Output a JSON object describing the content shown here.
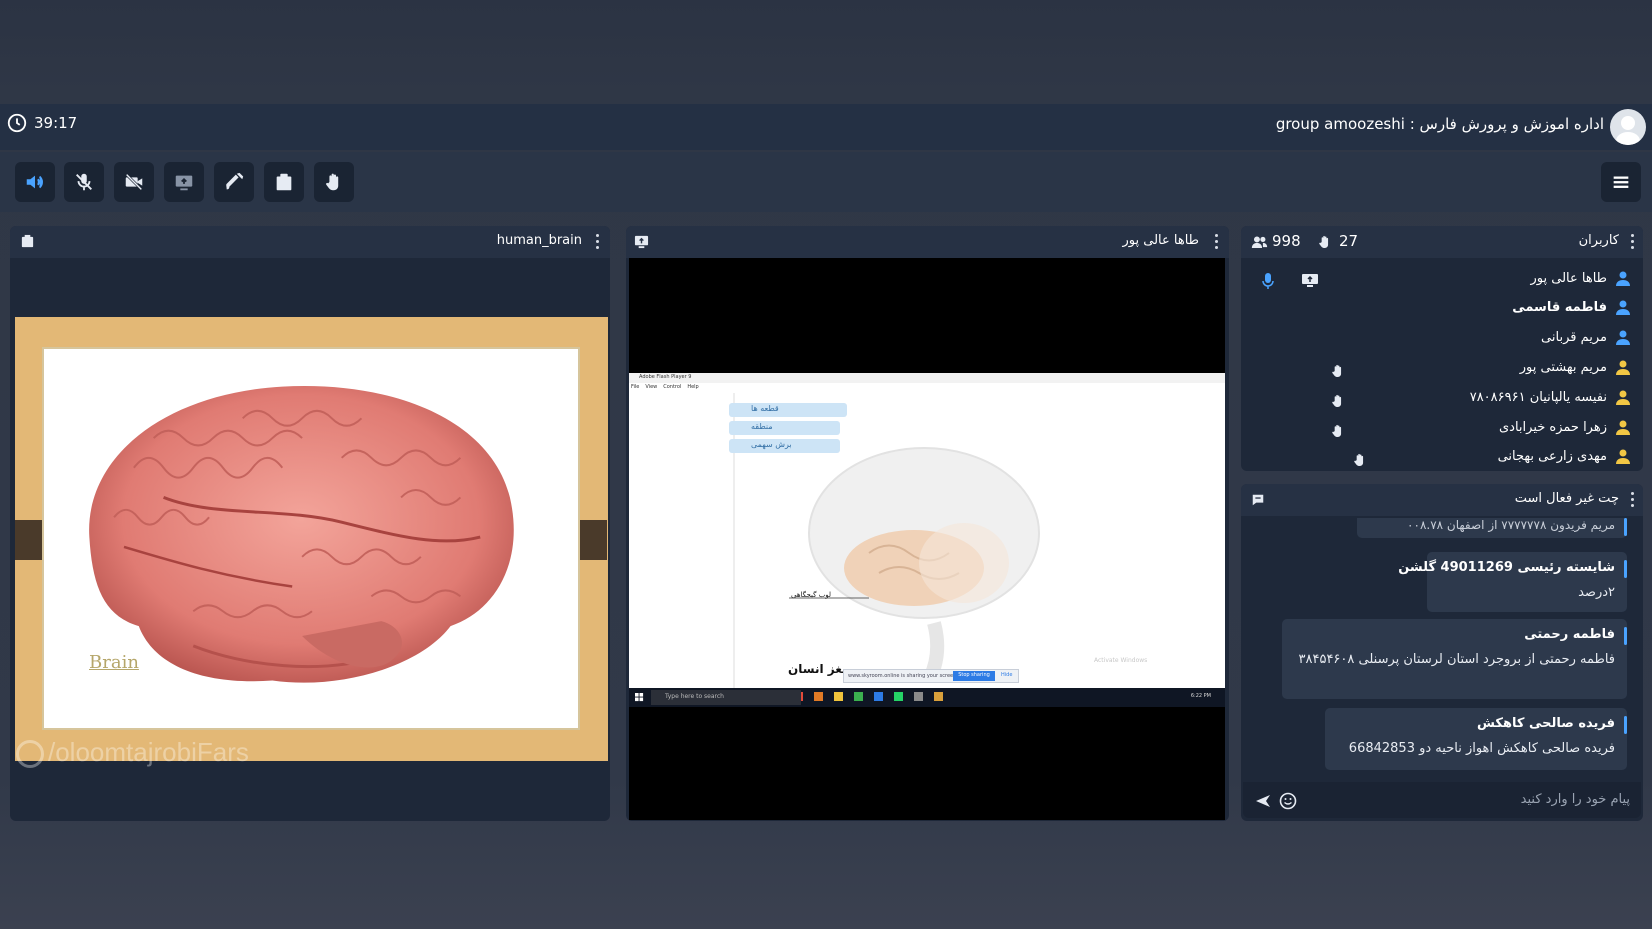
{
  "header": {
    "timer": "39:17",
    "room_title": "اداره اموزش و پرورش فارس : group amoozeshi"
  },
  "toolbar": {
    "buttons": [
      "speaker-icon",
      "mic-off-icon",
      "camera-off-icon",
      "screen-share-icon",
      "pen-icon",
      "whiteboard-icon",
      "raise-hand-icon"
    ],
    "accent_color": "#4aa3ff"
  },
  "left_panel": {
    "title": "human_brain",
    "slide_label": "Brain",
    "watermark": "/oloomtajrobiFars"
  },
  "middle_panel": {
    "title": "طاها عالی پور",
    "screen": {
      "window_title": "Adobe Flash Player 9",
      "menu_items": [
        "File",
        "View",
        "Control",
        "Help"
      ],
      "buttons": [
        "قطعه ها",
        "منطقه",
        "برش سهمی"
      ],
      "lobe_label": "لوب گیجگاهی",
      "caption": "مغز انسان",
      "share_text": "www.skyroom.online is sharing your screen.",
      "stop_sharing": "Stop sharing",
      "hide": "Hide",
      "search_placeholder": "Type here to search",
      "activate": "Activate Windows",
      "clock": "6:22 PM"
    }
  },
  "users_panel": {
    "title": "کاربران",
    "user_count": "998",
    "hand_count": "27",
    "users": [
      {
        "name": "طاها عالی پور",
        "role_color": "#4aa3ff",
        "bold": false
      },
      {
        "name": "فاطمه قاسمی",
        "role_color": "#4aa3ff",
        "bold": true
      },
      {
        "name": "مریم قربانی",
        "role_color": "#4aa3ff",
        "bold": false
      },
      {
        "name": "مریم بهشتی پور",
        "role_color": "#f2c744",
        "bold": false
      },
      {
        "name": "نفیسه یالپانیان ۷۸۰۸۶۹۶۱",
        "role_color": "#f2c744",
        "bold": false
      },
      {
        "name": "زهرا حمزه خیرابادی",
        "role_color": "#f2c744",
        "bold": false
      },
      {
        "name": "مهدی زارعی بهجانی",
        "role_color": "#f2c744",
        "bold": false
      }
    ]
  },
  "chat_panel": {
    "title": "چت غیر فعال است",
    "partial_message": "مریم فریدون ۷۷۷۷۷۷۸ از اصفهان ۰۰۸.۷۸",
    "messages": [
      {
        "author": "شایسته رئیسی 49011269 گلشن",
        "body": "۲درصد"
      },
      {
        "author": "فاطمه رحمتی",
        "body": "فاطمه رحمتی از بروجرد استان لرستان پرسنلی ۳۸۴۵۴۶۰۸"
      },
      {
        "author": "فریده صالحی کاهکش",
        "body": "فریده صالحی کاهکش اهواز ناحیه دو 66842853"
      }
    ],
    "input_placeholder": "پیام خود را وارد کنید"
  }
}
